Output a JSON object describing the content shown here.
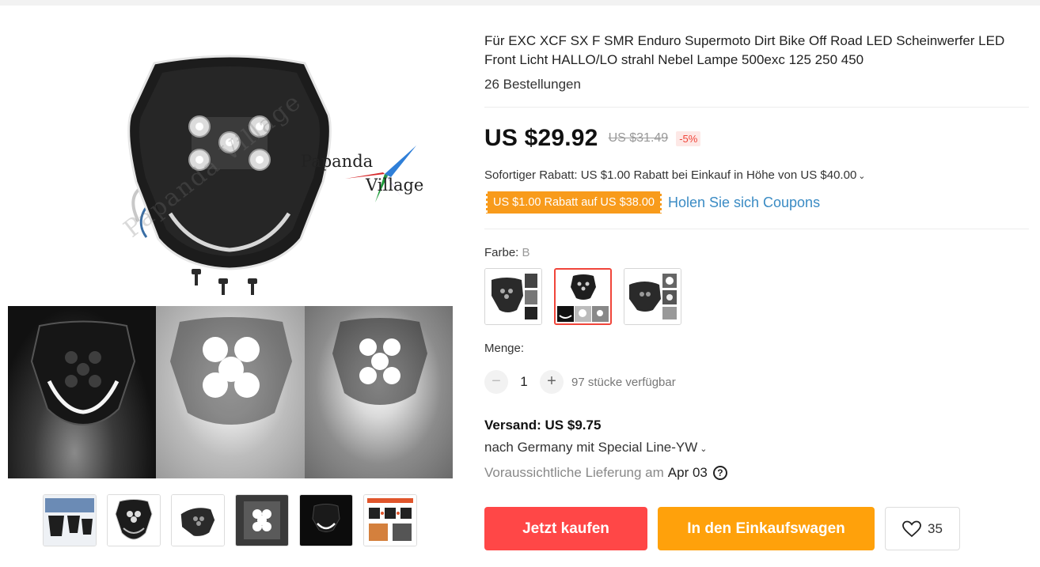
{
  "product": {
    "title": "Für EXC XCF SX F SMR Enduro Supermoto Dirt Bike Off Road LED Scheinwerfer LED Front Licht HALLO/LO strahl Nebel Lampe 500exc 125 250 450",
    "orders": "26 Bestellungen"
  },
  "gallery": {
    "logo_word_1": "Papanda",
    "logo_word_2": "Village",
    "watermark": "Papanda Village",
    "thumb_count": 6
  },
  "price": {
    "current": "US $29.92",
    "original": "US $31.49",
    "discount": "-5%"
  },
  "promo": {
    "rebate_text": "Sofortiger Rabatt: US $1.00 Rabatt bei Einkauf in Höhe von US $40.00",
    "coupon_tag": "US $1.00 Rabatt auf US $38.00",
    "coupon_link": "Holen Sie sich Coupons"
  },
  "variant": {
    "label": "Farbe:",
    "selected": "B"
  },
  "quantity": {
    "label": "Menge:",
    "minus": "−",
    "plus": "+",
    "value": "1",
    "available": "97 stücke verfügbar"
  },
  "shipping": {
    "title": "Versand: US $9.75",
    "destination": "nach Germany mit Special Line-YW",
    "delivery_label": "Voraussichtliche Lieferung am",
    "delivery_date": "Apr 03",
    "help_icon": "?"
  },
  "actions": {
    "buy_now": "Jetzt kaufen",
    "add_to_cart": "In den Einkaufswagen",
    "wishlist_count": "35"
  },
  "colors": {
    "price_red": "#ff4747",
    "cart_orange": "#ffa10b",
    "coupon_orange": "#f89b1b",
    "link_blue": "#3a8bc4",
    "selected_border": "#f0453a"
  },
  "icons": {
    "chevron": "chevron-down-icon",
    "help": "question-circle-icon",
    "wishlist": "heart-outline-icon"
  }
}
